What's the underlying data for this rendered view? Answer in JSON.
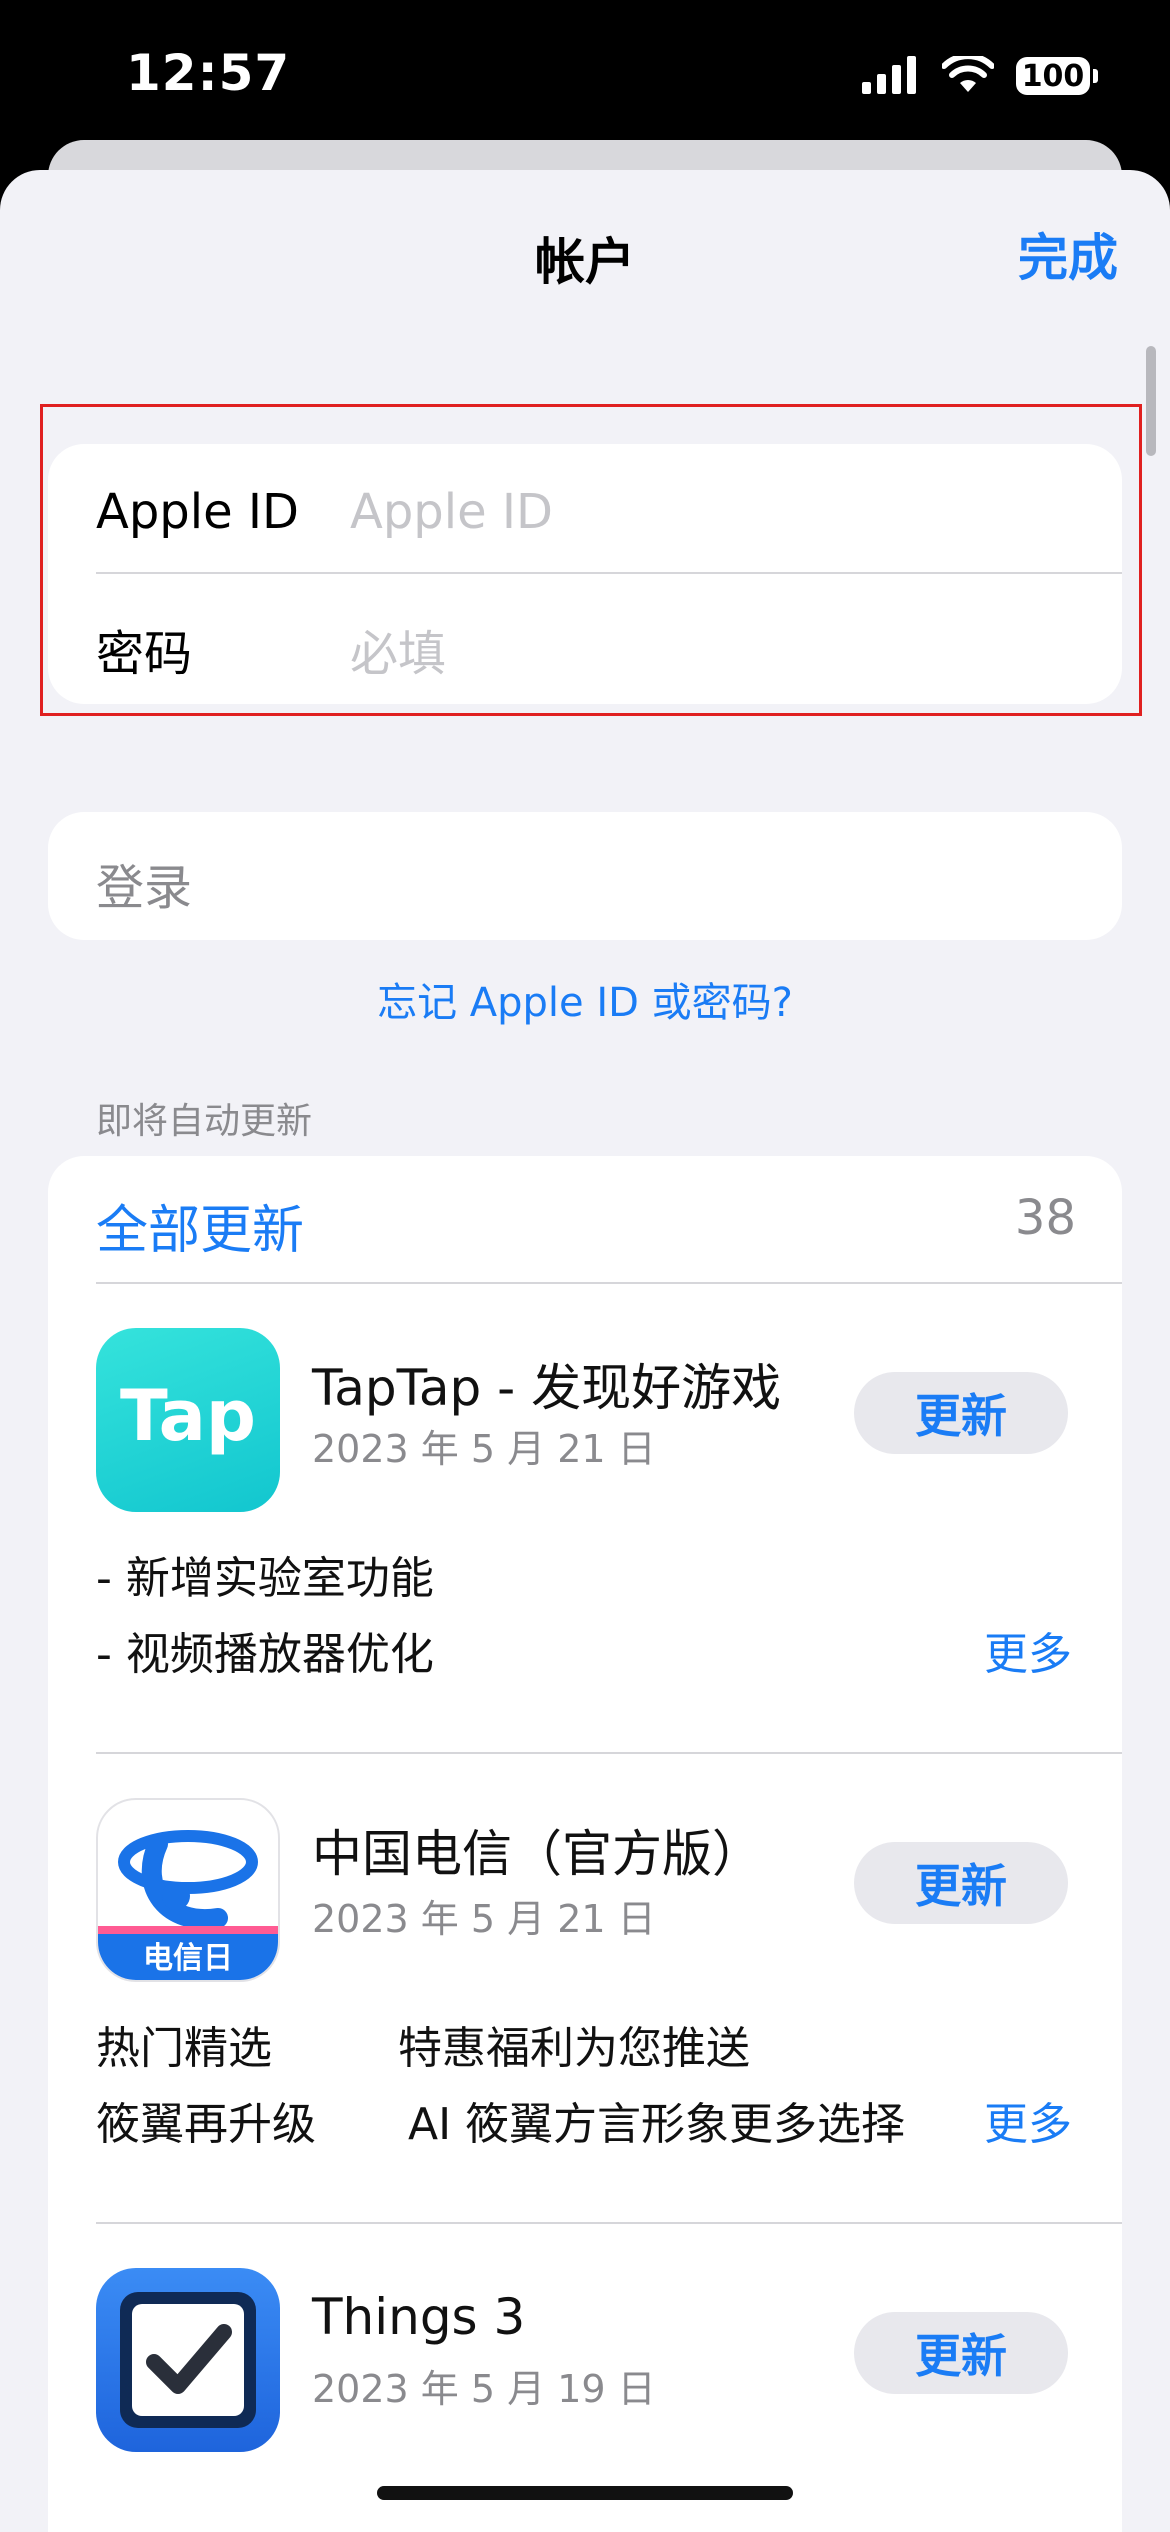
{
  "status": {
    "time": "12:57",
    "battery": "100"
  },
  "nav": {
    "title": "帐户",
    "done": "完成"
  },
  "login_form": {
    "apple_id_label": "Apple ID",
    "apple_id_placeholder": "Apple ID",
    "password_label": "密码",
    "password_placeholder": "必填"
  },
  "signin": {
    "label": "登录"
  },
  "forgot": {
    "label": "忘记 Apple ID 或密码?"
  },
  "updates": {
    "section_header": "即将自动更新",
    "update_all": "全部更新",
    "count": "38",
    "update_label": "更新",
    "more_label": "更多",
    "apps": [
      {
        "name": "TapTap - 发现好游戏",
        "date": "2023 年 5 月 21 日",
        "icon_text": "Tap",
        "notes": [
          "- 新增实验室功能",
          "- 视频播放器优化"
        ]
      },
      {
        "name": "中国电信（官方版）",
        "date": "2023 年 5 月 21 日",
        "icon_text": "电信日",
        "notes_left": [
          "热门精选",
          "筱翼再升级"
        ],
        "notes_right": [
          "特惠福利为您推送",
          "AI 筱翼方言形象更多选择"
        ]
      },
      {
        "name": "Things 3",
        "date": "2023 年 5 月 19 日"
      }
    ]
  },
  "colors": {
    "accent": "#1a7cf5",
    "sheet_bg": "#f2f2f7",
    "highlight": "#e02020"
  }
}
